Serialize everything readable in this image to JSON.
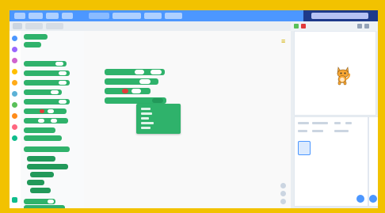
{
  "colors": {
    "frame": "#f2c200",
    "menubar": "#4c97ff",
    "menubar_dark": "#1e3a8a",
    "block_green": "#2fb26b",
    "input_red": "#e23b3b",
    "category_colors": [
      "#4c97ff",
      "#9966ff",
      "#cf63cf",
      "#ffbf00",
      "#ffab19",
      "#5cb1d6",
      "#59c059",
      "#ff8c1a",
      "#ff6680",
      "#0fbd8c",
      "#0fbd8c"
    ]
  },
  "icons": {
    "zoom_marker": "≡",
    "sprite": "cat-sprite-icon",
    "add_sprite": "add-sprite-icon",
    "add_backdrop": "add-backdrop-icon"
  }
}
